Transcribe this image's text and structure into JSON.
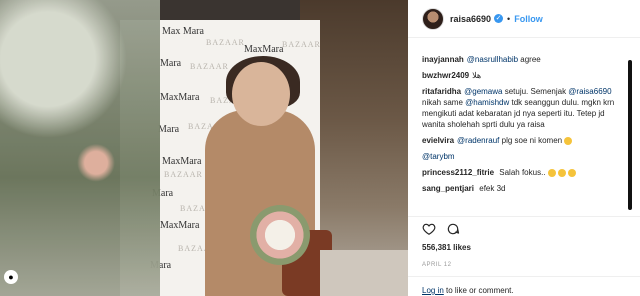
{
  "photo": {
    "brands": [
      "Max Mara",
      "BAZAAR",
      "MaxMara",
      "BAZAAR",
      "Mara",
      "BAZAAR",
      "MaxMara",
      "BAZAAR",
      "Mara",
      "BAZAAR",
      "MaxMara",
      "BAZAAR",
      "Mara",
      "BAZAAR",
      "MaxMara",
      "BAZAAR",
      "Mara"
    ]
  },
  "post": {
    "username": "raisa6690",
    "follow_label": "Follow",
    "separator": "•",
    "comments": [
      {
        "user": "inayjannah",
        "parts": [
          {
            "mention": "@nasrullhabib"
          },
          {
            "text": " agree"
          }
        ]
      },
      {
        "user": "bwzhwr2409",
        "parts": [
          {
            "text": "هلا"
          }
        ]
      },
      {
        "user": "ritafaridha",
        "parts": [
          {
            "mention": "@gemawa"
          },
          {
            "text": " setuju. Semenjak "
          },
          {
            "mention": "@raisa6690"
          },
          {
            "text": " nikah same "
          },
          {
            "mention": "@hamishdw"
          },
          {
            "text": " tdk seanggun dulu. mgkn krn mengikuti adat kebaratan jd nya seperti itu. Tetep jd wanita sholehah sprti dulu ya raisa"
          }
        ]
      },
      {
        "user": "evielvira",
        "parts": [
          {
            "mention": "@radenrauf"
          },
          {
            "text": " plg soe ni komen"
          }
        ],
        "emoji": 1
      },
      {
        "user": "",
        "parts": [
          {
            "mention": "@tarybm"
          }
        ]
      },
      {
        "user": "princess2112_fitrie",
        "parts": [
          {
            "text": " Salah fokus.."
          }
        ],
        "emoji": 3
      },
      {
        "user": "sang_pentjari",
        "parts": [
          {
            "text": " efek 3d"
          }
        ]
      }
    ],
    "likes": "556,381 likes",
    "date": "APRIL 12",
    "login_link": "Log in",
    "login_rest": " to like or comment."
  }
}
